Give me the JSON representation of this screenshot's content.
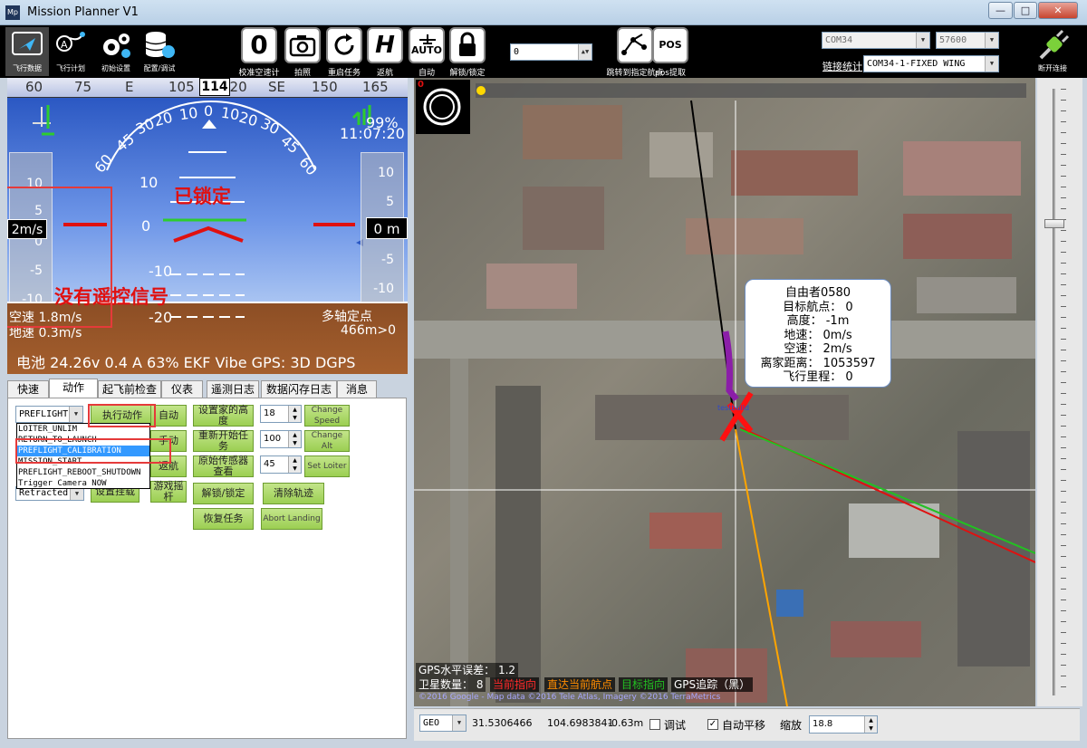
{
  "window": {
    "title": "Mission Planner V1",
    "app_icon": "Mp",
    "min": "—",
    "max": "□",
    "close": "✕"
  },
  "nav": [
    {
      "label": "飞行数据",
      "icon": "plane-screen-icon"
    },
    {
      "label": "飞行计划",
      "icon": "waypoint-icon"
    },
    {
      "label": "初始设置",
      "icon": "gears-icon"
    },
    {
      "label": "配置/调试",
      "icon": "database-gear-icon"
    }
  ],
  "tools": [
    {
      "label": "校准空速计",
      "glyph": "0"
    },
    {
      "label": "拍照",
      "glyph": "📷"
    },
    {
      "label": "重启任务",
      "glyph": "⟳"
    },
    {
      "label": "返航",
      "glyph": "H"
    },
    {
      "label": "自动",
      "glyph": "AUTO"
    },
    {
      "label": "解锁/锁定",
      "glyph": "🔒"
    },
    {
      "label": "跳转到指定航点",
      "glyph": "⤴"
    },
    {
      "label": "pos提取",
      "glyph": "POS"
    }
  ],
  "wp_input": "0",
  "conn": {
    "port": "COM34",
    "baud": "57600",
    "link_label": "链接统计",
    "link_value": "COM34-1-FIXED WING",
    "disconnect_label": "断开连接"
  },
  "hud": {
    "compass_ticks": [
      "60",
      "75",
      "E",
      "105",
      "120",
      "SE",
      "150",
      "165"
    ],
    "heading": "114",
    "roll_ticks": [
      "60",
      "45",
      "30",
      "20",
      "10",
      "0",
      "10",
      "20",
      "30",
      "45",
      "60"
    ],
    "battery_pct": "99%",
    "time": "11:07:20",
    "armed": "已锁定",
    "no_rc": "没有遥控信号",
    "speed_box": "2m/s",
    "alt_box": "0 m",
    "left_tape": [
      "10",
      "5",
      "0",
      "-5",
      "-10"
    ],
    "right_tape": [
      "10",
      "5",
      "-5",
      "-10"
    ],
    "pitch_labels": [
      "10",
      "0",
      "-10",
      "-20"
    ],
    "airspeed": "空速 1.8m/s",
    "groundspeed": "地速 0.3m/s",
    "mode": "多轴定点",
    "home_dist": "466m>0",
    "status": "电池 24.26v 0.4 A 63%   EKF   Vibe   GPS: 3D DGPS"
  },
  "tabs": [
    "快速",
    "动作",
    "起飞前检查",
    "仪表",
    "遥测日志",
    "数据闪存日志",
    "消息"
  ],
  "actions": {
    "combo1": "PREFLIGHT",
    "combo2": "Retracted",
    "execute": "执行动作",
    "auto": "自动",
    "manual": "手动",
    "rtl": "返航",
    "set_home": "设置家的高度",
    "restart": "重新开始任务",
    "raw_sensor": "原始传感器查看",
    "set_mount": "设置挂载",
    "joystick": "游戏摇杆",
    "arm": "解锁/锁定",
    "clear_track": "清除轨迹",
    "resume": "恢复任务",
    "change_speed": "Change Speed",
    "change_alt": "Change Alt",
    "set_loiter": "Set Loiter",
    "abort_landing": "Abort Landing",
    "speed_val": "18",
    "alt_val": "100",
    "loiter_val": "45"
  },
  "dropdown": [
    "LOITER_UNLIM",
    "RETURN_TO_LAUNCH",
    "PREFLIGHT_CALIBRATION",
    "MISSION_START",
    "PREFLIGHT_REBOOT_SHUTDOWN",
    "Trigger Camera NOW"
  ],
  "map": {
    "popup": [
      "自由者0580",
      "目标航点： 0",
      "高度： -1m",
      "地速： 0m/s",
      "空速： 2m/s",
      "离家距离： 1053597",
      "飞行里程： 0"
    ],
    "hdop": "GPS水平误差： 1.2",
    "sats": "卫星数量： 8",
    "leg_heading": "当前指向",
    "leg_target": "直达当前航点",
    "leg_nav": "目标指向",
    "leg_gps": "GPS追踪（黑）",
    "copyright": "©2016 Google - Map data ©2016 Tele Atlas, Imagery ©2016 TerraMetrics",
    "vehicle_label": "testbuild",
    "red_num": "0"
  },
  "bottom": {
    "geo": "GEO",
    "lat": "31.5306466",
    "lon": "104.6983841",
    "alt": "-0.63m",
    "debug": "调试",
    "autopan": "自动平移",
    "zoom_label": "缩放",
    "zoom": "18.8"
  },
  "colors": {
    "armed": "#e01010",
    "popup_border": "#6c8cbf",
    "legend_heading": "#ff2a2a",
    "legend_target": "#ff8c00",
    "legend_nav": "#22c022"
  }
}
